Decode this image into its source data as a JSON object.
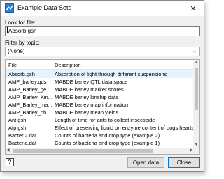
{
  "window": {
    "title": "Example Data Sets"
  },
  "look_for_file": {
    "label": "Look for file:",
    "value": "Absorb.gsh"
  },
  "filter": {
    "label": "Filter by topic:",
    "selected": "(None)"
  },
  "table": {
    "columns": [
      "File",
      "Description"
    ],
    "rows": [
      {
        "file": "Absorb.gsh",
        "description": "Absorption of light through different suspensions",
        "selected": true
      },
      {
        "file": "AMP_barley.qds",
        "description": "MABDE barley QTL data space"
      },
      {
        "file": "AMP_Barley_ge...",
        "description": "MABDE barley marker scores"
      },
      {
        "file": "AMP_Barley_Kin...",
        "description": "MABDE barley kinship data"
      },
      {
        "file": "AMP_Barley_ma...",
        "description": "MABDE barley map information"
      },
      {
        "file": "AMP_Barley_ph...",
        "description": "MABDE barley mean yields"
      },
      {
        "file": "Ant.gsh",
        "description": "Length of time for ants to collect insecticide"
      },
      {
        "file": "Atp.gsh",
        "description": "Effect of preserving liquid on enzyme content of dogs hearts"
      },
      {
        "file": "Bacteri2.dat",
        "description": "Counts of bacteria and crop type (example 2)"
      },
      {
        "file": "Bacteria.dat",
        "description": "Counts of bacteria and crop type (example 1)"
      }
    ]
  },
  "buttons": {
    "help": "?",
    "open": "Open data",
    "close": "Close"
  },
  "colors": {
    "selected_row": "#e5f3ff",
    "default_button_border": "#0078d7"
  }
}
